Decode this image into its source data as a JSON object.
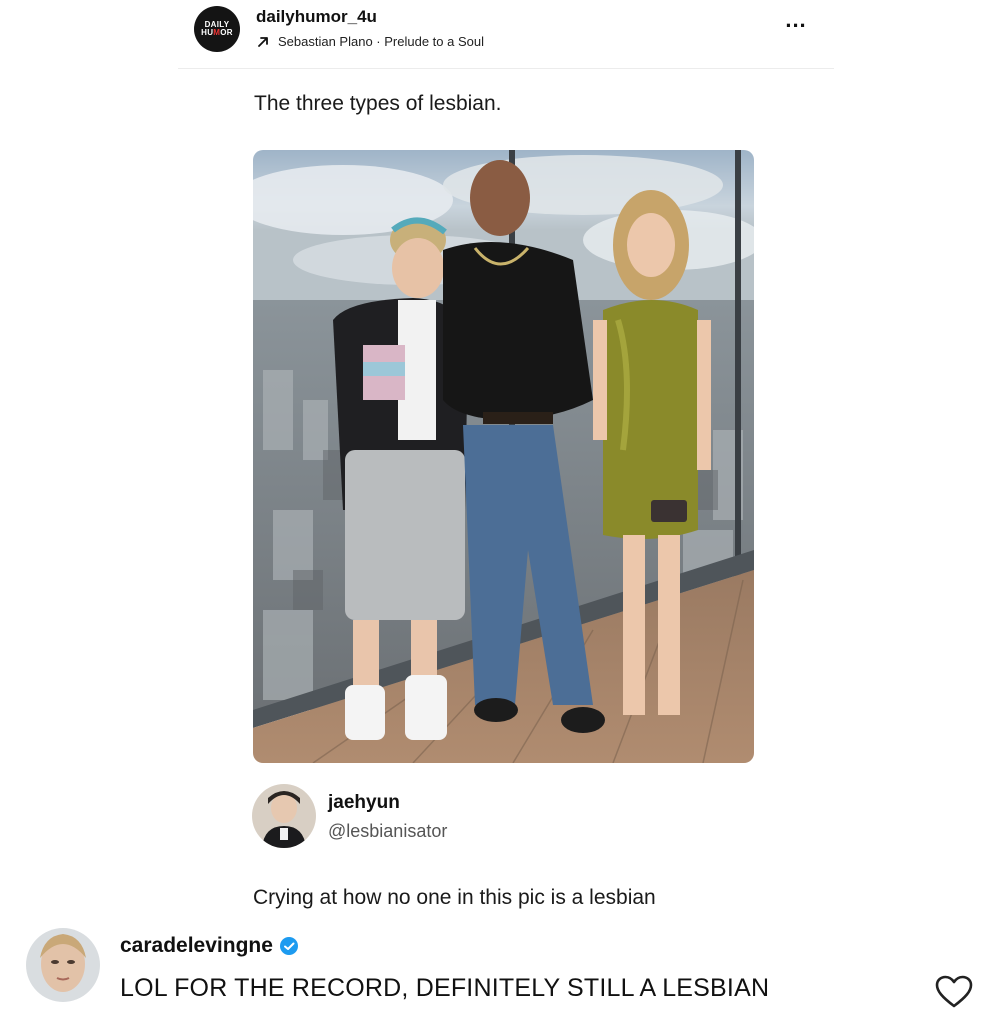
{
  "post": {
    "account": {
      "username": "dailyhumor_4u",
      "avatar_text_line1": "DAILY",
      "avatar_text_line2a": "HU",
      "avatar_text_dot": "M",
      "avatar_text_line2b": "OR"
    },
    "music": {
      "artist": "Sebastian Plano",
      "separator": " · ",
      "track": "Prelude to a Soul",
      "icon": "arrow-up-right-icon"
    },
    "more_label": "...",
    "caption": "The three types of lesbian."
  },
  "quoted_tweet": {
    "name": "jaehyun",
    "handle": "@lesbianisator",
    "text": "Crying at how no one in this pic is a lesbian"
  },
  "comment": {
    "username": "caradelevingne",
    "verified_icon": "verified-badge-icon",
    "text": "LOL FOR THE RECORD, DEFINITELY STILL A LESBIAN",
    "like_icon": "heart-icon"
  },
  "colors": {
    "verified_blue": "#1d9bf0",
    "dress_green": "#8a8a2a"
  }
}
